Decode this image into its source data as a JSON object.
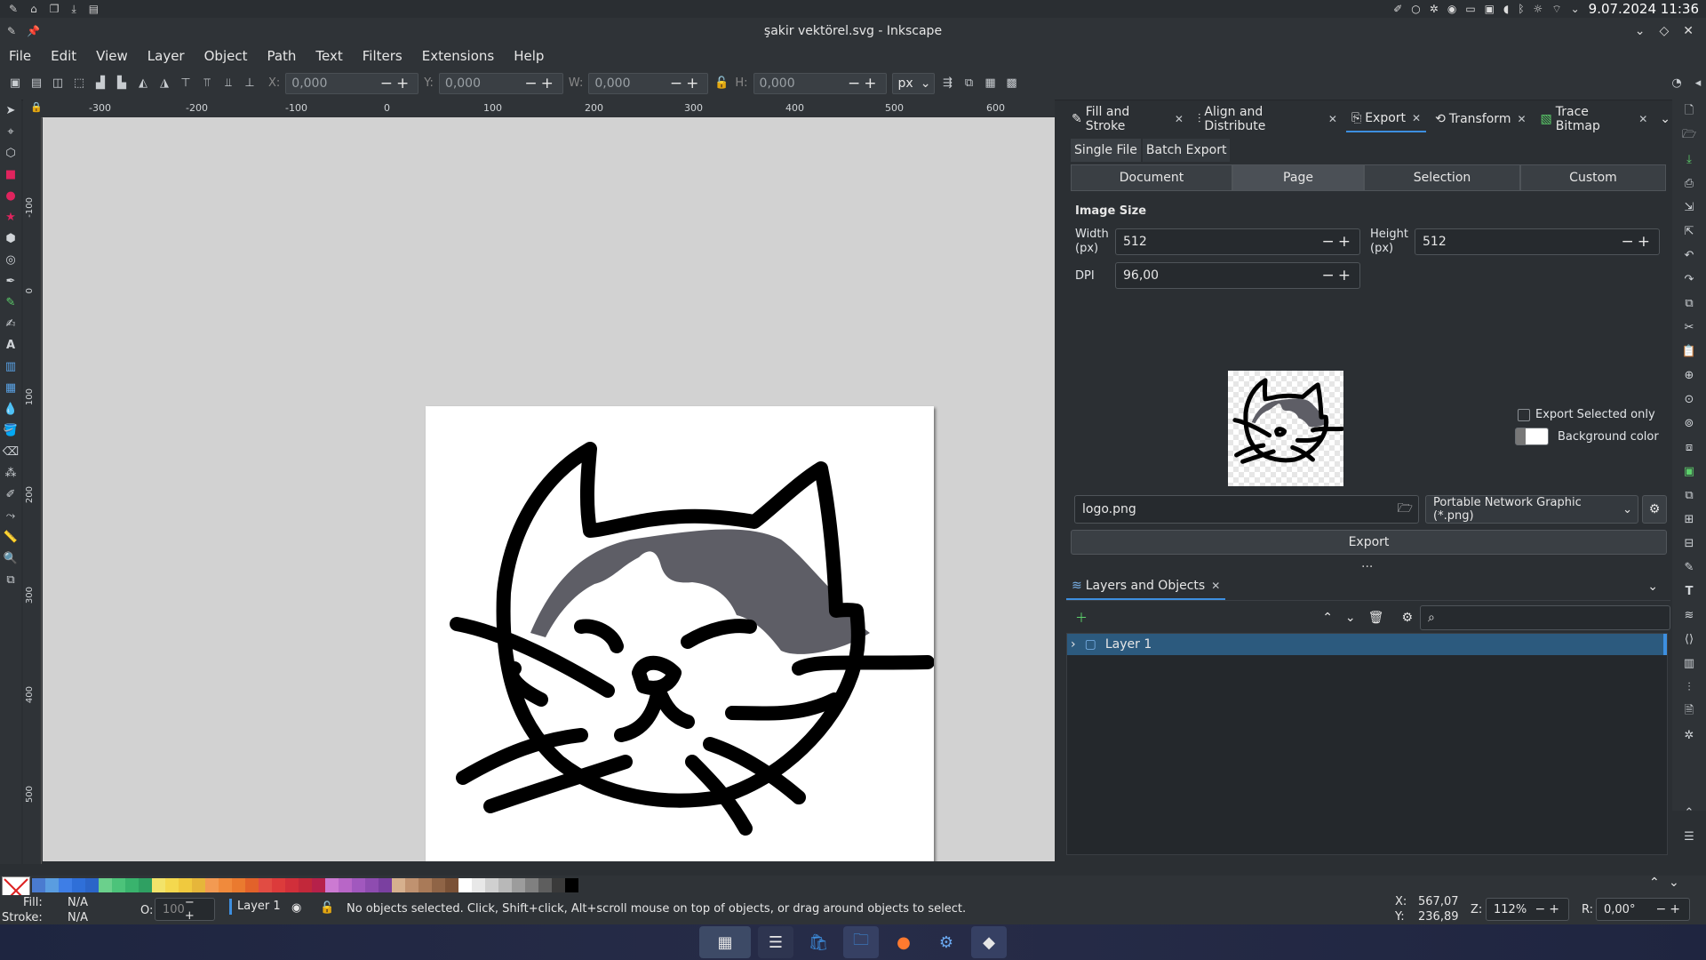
{
  "system_bar": {
    "datetime": "9.07.2024 11:36"
  },
  "window": {
    "title": "şakir vektörel.svg - Inkscape"
  },
  "menu": [
    "File",
    "Edit",
    "View",
    "Layer",
    "Object",
    "Path",
    "Text",
    "Filters",
    "Extensions",
    "Help"
  ],
  "toolbar": {
    "x_label": "X:",
    "x_value": "0,000",
    "y_label": "Y:",
    "y_value": "0,000",
    "w_label": "W:",
    "w_value": "0,000",
    "h_label": "H:",
    "h_value": "0,000",
    "unit": "px"
  },
  "ruler": {
    "h_ticks": [
      "-300",
      "-200",
      "-100",
      "0",
      "100",
      "200",
      "300",
      "400",
      "500",
      "600"
    ],
    "v_ticks": [
      "-100",
      "0",
      "100",
      "200",
      "300",
      "400",
      "500"
    ]
  },
  "dock_tabs": [
    {
      "label": "Fill and Stroke",
      "icon": "fill-stroke-icon"
    },
    {
      "label": "Align and Distribute",
      "icon": "align-icon"
    },
    {
      "label": "Export",
      "icon": "export-icon",
      "active": true
    },
    {
      "label": "Transform",
      "icon": "transform-icon"
    },
    {
      "label": "Trace Bitmap",
      "icon": "trace-icon"
    }
  ],
  "export": {
    "sub_tabs": [
      "Single File",
      "Batch Export"
    ],
    "areas": [
      "Document",
      "Page",
      "Selection",
      "Custom"
    ],
    "active_area": "Page",
    "image_size_title": "Image Size",
    "width_label": "Width\n(px)",
    "width_value": "512",
    "height_label": "Height\n(px)",
    "height_value": "512",
    "dpi_label": "DPI",
    "dpi_value": "96,00",
    "export_selected_label": "Export Selected only",
    "background_label": "Background color",
    "filename": "logo.png",
    "format": "Portable Network Graphic (*.png)",
    "export_button": "Export",
    "more": "..."
  },
  "layers": {
    "tab": "Layers and Objects",
    "items": [
      {
        "label": "Layer 1"
      }
    ]
  },
  "status": {
    "fill_label": "Fill:",
    "fill_value": "N/A",
    "stroke_label": "Stroke:",
    "stroke_value": "N/A",
    "opacity_label": "O:",
    "opacity_value": "100",
    "layer": "Layer 1",
    "message": "No objects selected. Click, Shift+click, Alt+scroll mouse on top of objects, or drag around objects to select.",
    "x_label": "X:",
    "x_value": "567,07",
    "y_label": "Y:",
    "y_value": "236,89",
    "zoom_label": "Z:",
    "zoom_value": "112%",
    "rotation_label": "R:",
    "rotation_value": "0,00°"
  },
  "palette": [
    "#4a7bd0",
    "#5a9de0",
    "#3e7ee6",
    "#2f6fd8",
    "#2b65c8",
    "#6bd08c",
    "#4cc37a",
    "#39b36d",
    "#2fa062",
    "#f2e36a",
    "#f4d84e",
    "#f0c93e",
    "#e6b63a",
    "#f39a52",
    "#f08a3c",
    "#ea7a2f",
    "#e2622a",
    "#e14c43",
    "#dc3b3b",
    "#d12f3a",
    "#c2283a",
    "#b6214a",
    "#cc7ad2",
    "#b866c7",
    "#a158be",
    "#8e4cb0",
    "#7a40a0",
    "#d6b08e",
    "#c09270",
    "#a97a58",
    "#8f6446",
    "#7a5136",
    "#ffffff",
    "#e8e8e8",
    "#d0d0d0",
    "#b8b8b8",
    "#9c9c9c",
    "#808080",
    "#5e5e5e",
    "#3a3a3a",
    "#000000"
  ]
}
